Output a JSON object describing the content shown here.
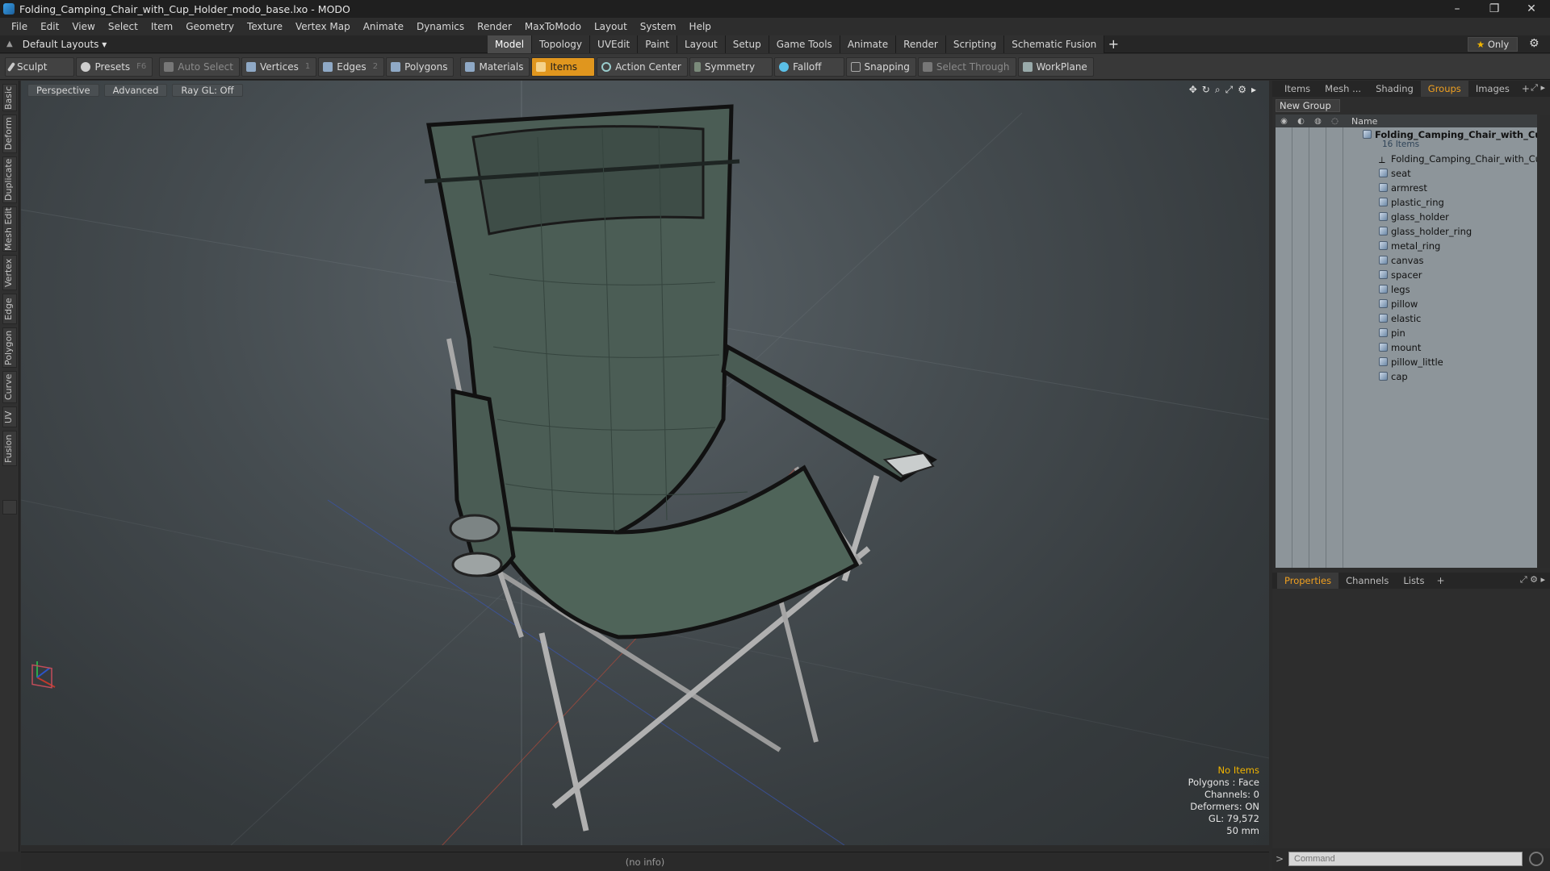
{
  "window": {
    "title": "Folding_Camping_Chair_with_Cup_Holder_modo_base.lxo - MODO",
    "minimize": "–",
    "maximize": "❐",
    "close": "✕"
  },
  "menu": [
    "File",
    "Edit",
    "View",
    "Select",
    "Item",
    "Geometry",
    "Texture",
    "Vertex Map",
    "Animate",
    "Dynamics",
    "Render",
    "MaxToModo",
    "Layout",
    "System",
    "Help"
  ],
  "layoutbar": {
    "layout_selector": "Default Layouts ▾",
    "tabs": [
      "Model",
      "Topology",
      "UVEdit",
      "Paint",
      "Layout",
      "Setup",
      "Game Tools",
      "Animate",
      "Render",
      "Scripting",
      "Schematic Fusion"
    ],
    "active_tab": "Model",
    "add": "+",
    "only_star": "★",
    "only_label": "Only",
    "gear": "⚙"
  },
  "toolbar": {
    "sculpt": "Sculpt",
    "presets": "Presets",
    "presets_key": "F6",
    "auto_select": "Auto Select",
    "vertices": "Vertices",
    "vertices_key": "1",
    "edges": "Edges",
    "edges_key": "2",
    "polygons": "Polygons",
    "materials": "Materials",
    "items": "Items",
    "action_center": "Action Center",
    "symmetry": "Symmetry",
    "falloff": "Falloff",
    "snapping": "Snapping",
    "select_through": "Select Through",
    "workplane": "WorkPlane"
  },
  "leftstrip": [
    "Basic",
    "Deform",
    "Duplicate",
    "Mesh Edit",
    "Vertex",
    "Edge",
    "Polygon",
    "Curve",
    "UV",
    "Fusion"
  ],
  "viewport": {
    "perspective": "Perspective",
    "advanced": "Advanced",
    "raygl": "Ray GL: Off",
    "icons": [
      "✥",
      "↻",
      "⌕",
      "⤢",
      "⚙",
      "▸"
    ],
    "info": {
      "no_items": "No Items",
      "polygons": "Polygons : Face",
      "channels": "Channels: 0",
      "deformers": "Deformers: ON",
      "gl": "GL: 79,572",
      "focal": "50 mm"
    }
  },
  "status": "(no info)",
  "groups_panel": {
    "tabs": [
      "Items",
      "Mesh ...",
      "Shading",
      "Groups",
      "Images"
    ],
    "active": "Groups",
    "plus": "+",
    "new_group": "New Group",
    "header_name": "Name",
    "root": "Folding_Camping_Chair_with_Cu...",
    "root_count": "16 Items",
    "items": [
      "Folding_Camping_Chair_with_Cup_...",
      "seat",
      "armrest",
      "plastic_ring",
      "glass_holder",
      "glass_holder_ring",
      "metal_ring",
      "canvas",
      "spacer",
      "legs",
      "pillow",
      "elastic",
      "pin",
      "mount",
      "pillow_little",
      "cap"
    ]
  },
  "props_panel": {
    "tabs": [
      "Properties",
      "Channels",
      "Lists"
    ],
    "active": "Properties",
    "plus": "+"
  },
  "command": {
    "prompt": ">",
    "placeholder": "Command"
  }
}
